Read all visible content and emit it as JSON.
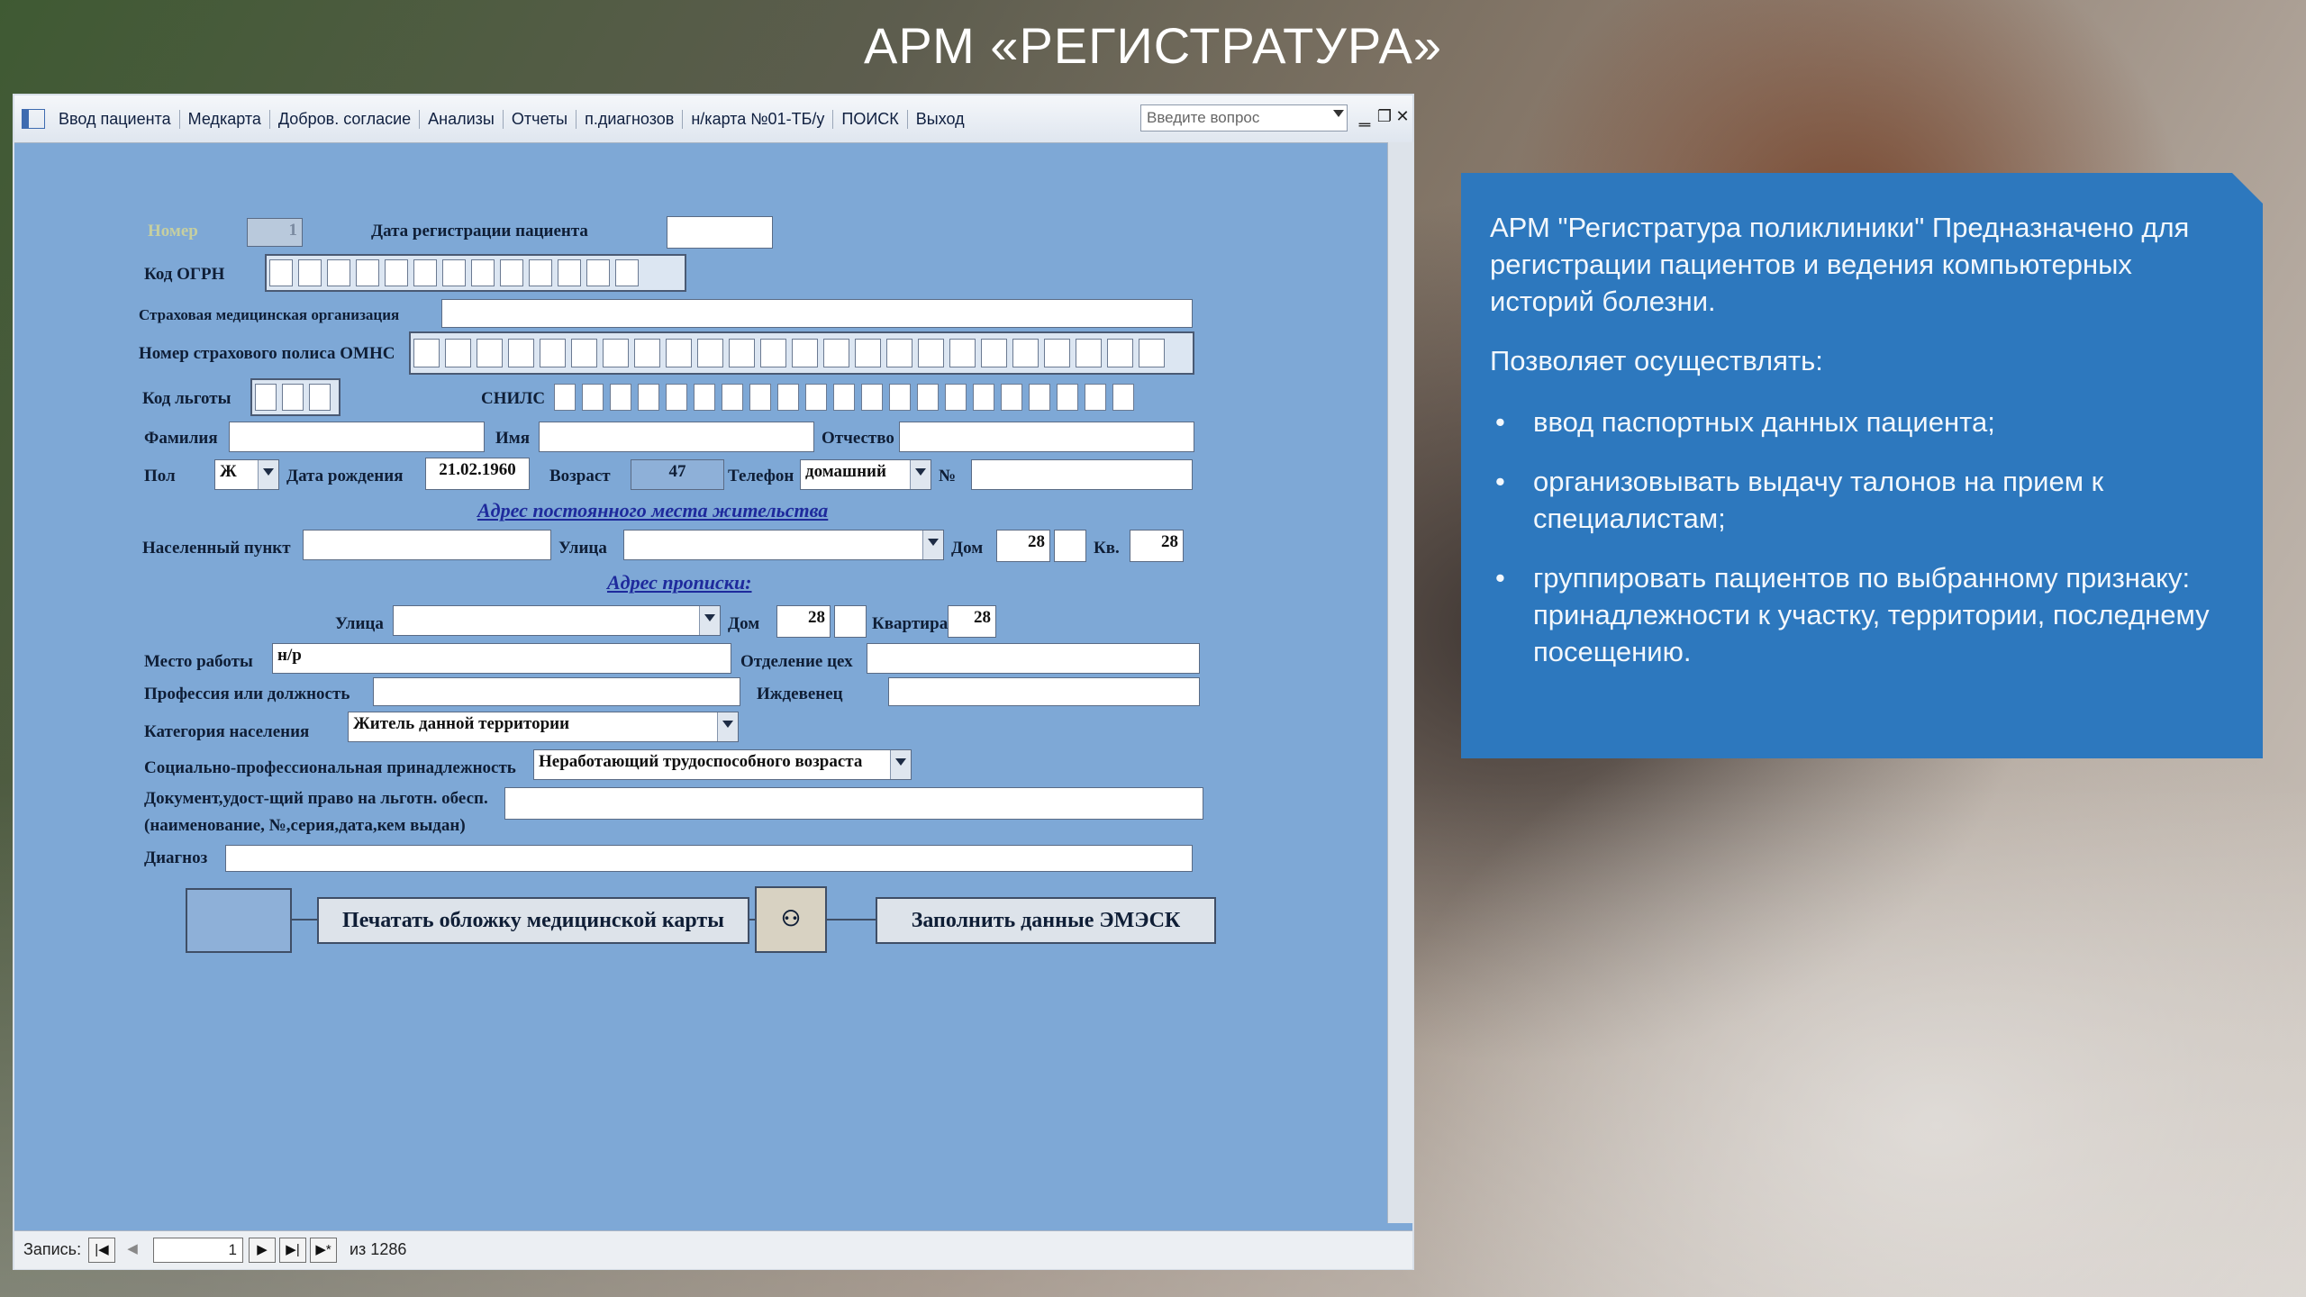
{
  "slide": {
    "title": "АРМ «РЕГИСТРАТУРА»",
    "panel": {
      "paragraph1": "АРМ \"Регистратура поликлиники\" Предназначено для регистрации пациентов и ведения компьютерных историй болезни.",
      "paragraph2": "Позволяет осуществлять:",
      "bullets": [
        "ввод паспортных данных пациента;",
        "организовывать выдачу талонов на прием к специалистам;",
        "группировать пациентов по выбранному признаку: принадлежности к участку, территории, последнему посещению."
      ]
    }
  },
  "menubar": {
    "items": [
      "Ввод пациента",
      "Медкарта",
      "Добров. согласие",
      "Анализы",
      "Отчеты",
      "п.диагнозов",
      "н/карта №01-ТБ/у",
      "ПОИСК",
      "Выход"
    ],
    "ask_placeholder": "Введите вопрос",
    "minimize": "‗",
    "restore": "❐",
    "close": "✕"
  },
  "form": {
    "labels": {
      "nomer": "Номер",
      "reg_date": "Дата регистрации пациента",
      "ogrn": "Код ОГРН",
      "insurer": "Страховая медицинская организация",
      "policy": "Номер страхового полиса ОМНС",
      "benefit_code": "Код льготы",
      "snils": "СНИЛС",
      "surname": "Фамилия",
      "name": "Имя",
      "patronymic": "Отчество",
      "sex": "Пол",
      "birth_date": "Дата рождения",
      "age": "Возраст",
      "phone": "Телефон",
      "number_sign": "№",
      "locality": "Населенный пункт",
      "street": "Улица",
      "house": "Дом",
      "apt_short": "Кв.",
      "street2": "Улица",
      "house2": "Дом",
      "apartment": "Квартира",
      "workplace": "Место работы",
      "department": "Отделение цех",
      "profession": "Профессия или должность",
      "dependent": "Иждевенец",
      "category": "Категория населения",
      "social": "Социально-профессиональная принадлежность",
      "doc_line1": "Документ,удост-щий право на льготн. обесп.",
      "doc_line2": "(наименование, №,серия,дата,кем выдан)",
      "diagnosis": "Диагноз"
    },
    "values": {
      "nomer": "1",
      "sex": "Ж",
      "birth_date": "21.02.1960",
      "age": "47",
      "phone_type": "домашний",
      "house": "28",
      "apt": "28",
      "house2": "28",
      "apartment": "28",
      "workplace": "н/р",
      "category": "Житель данной территории",
      "social": "Неработающий трудоспособного возраста"
    },
    "sections": {
      "residence": "Адрес постоянного места жительства",
      "registration": "Адрес прописки:"
    },
    "buttons": {
      "print_cover": "Печатать обложку медицинской карты",
      "fill_emesk": "Заполнить данные ЭМЭСК",
      "binoculars": "⚇"
    }
  },
  "statusbar": {
    "record_label": "Запись:",
    "first": "|◀",
    "prev": "◀",
    "current": "1",
    "next": "▶",
    "last": "▶|",
    "new": "▶*",
    "total": "из  1286"
  }
}
